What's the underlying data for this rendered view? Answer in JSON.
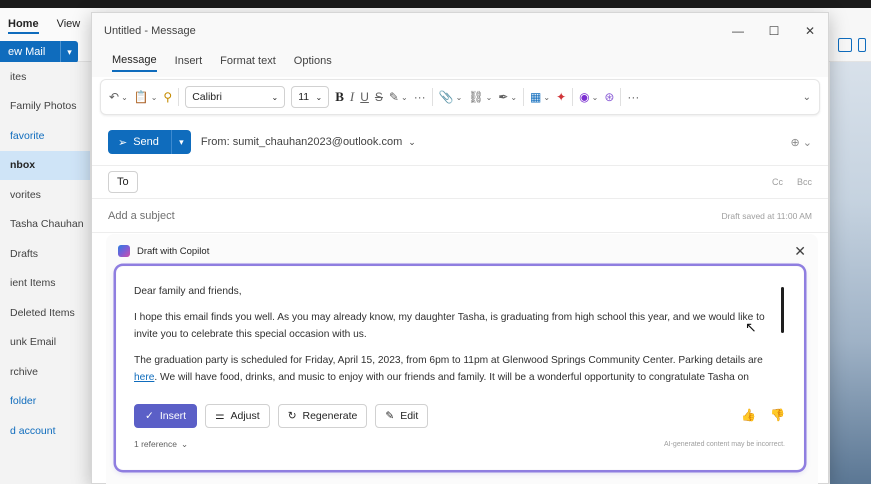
{
  "outlook": {
    "tabs": [
      "Home",
      "View"
    ],
    "new_mail": "ew Mail",
    "folders": [
      "ites",
      "Family Photos",
      "favorite",
      "nbox",
      "vorites",
      "Tasha Chauhan",
      "Drafts",
      "ient Items",
      "Deleted Items",
      "unk Email",
      "rchive",
      "folder",
      "d account"
    ]
  },
  "window": {
    "title": "Untitled - Message",
    "minimize": "—",
    "maximize": "☐",
    "close": "✕"
  },
  "ribbon_tabs": [
    "Message",
    "Insert",
    "Format text",
    "Options"
  ],
  "toolbar": {
    "font": "Calibri",
    "size": "11"
  },
  "compose": {
    "send_label": "Send",
    "from": "From: sumit_chauhan2023@outlook.com",
    "to_label": "To",
    "cc": "Cc",
    "bcc": "Bcc",
    "subject_placeholder": "Add a subject",
    "draft_saved": "Draft saved at 11:00 AM"
  },
  "copilot": {
    "title": "Draft with Copilot",
    "greeting": "Dear family and friends,",
    "para1": "I hope this email finds you well. As you may already know, my daughter Tasha, is graduating from high school this year, and we would like to invite you to celebrate this special occasion with us.",
    "para2_start": "The graduation party is scheduled for Friday, April 15, 2023, from 6pm to 11pm at Glenwood Springs Community Center. Parking details are ",
    "para2_link": "here",
    "para2_end": ". We will have food, drinks, and music to enjoy with our friends and family. It will be a wonderful opportunity to congratulate Tasha on",
    "insert": "Insert",
    "adjust": "Adjust",
    "regenerate": "Regenerate",
    "edit": "Edit",
    "references": "1 reference",
    "disclaimer": "AI-generated content may be incorrect."
  }
}
